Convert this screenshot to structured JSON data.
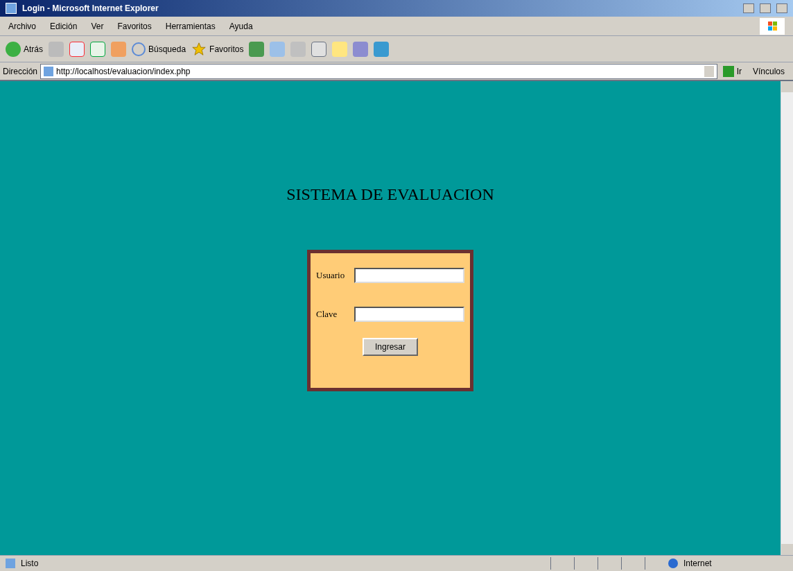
{
  "window": {
    "title": "Login - Microsoft Internet Explorer"
  },
  "menu": [
    "Archivo",
    "Edición",
    "Ver",
    "Favoritos",
    "Herramientas",
    "Ayuda"
  ],
  "toolbar": {
    "back": "Atrás",
    "search": "Búsqueda",
    "favorites": "Favoritos"
  },
  "address_bar": {
    "label": "Dirección",
    "value": "http://localhost/evaluacion/index.php",
    "go": "Ir",
    "links": "Vínculos"
  },
  "page": {
    "heading": "SISTEMA DE EVALUACION",
    "form": {
      "fields": [
        {
          "label": "Usuario"
        },
        {
          "label": "Clave"
        }
      ],
      "submit": "Ingresar"
    }
  },
  "status_bar": {
    "text": "Listo",
    "zone": "Internet"
  }
}
